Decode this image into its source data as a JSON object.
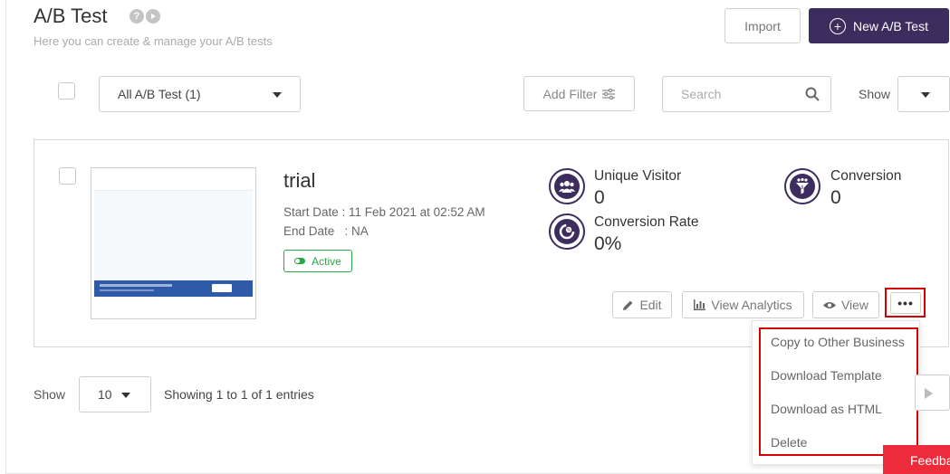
{
  "header": {
    "title": "A/B Test",
    "subtitle": "Here you can create & manage your A/B tests",
    "help_icon": "question-icon",
    "video_icon": "play-icon",
    "import_label": "Import",
    "new_label": "New A/B Test"
  },
  "toolbar": {
    "filter_select_value": "All A/B Test (1)",
    "add_filter_label": "Add Filter",
    "search_placeholder": "Search",
    "show_label": "Show"
  },
  "test_card": {
    "name": "trial",
    "start_date": "Start Date : 11 Feb 2021 at 02:52 AM",
    "end_date": "End Date   : NA",
    "status": "Active",
    "metrics": {
      "unique_visitor_label": "Unique Visitor",
      "unique_visitor_value": "0",
      "conversion_label": "Conversion",
      "conversion_value": "0",
      "conversion_rate_label": "Conversion Rate",
      "conversion_rate_value": "0%"
    },
    "actions": {
      "edit": "Edit",
      "view_analytics": "View Analytics",
      "view": "View",
      "more": "•••"
    }
  },
  "more_menu": [
    "Copy to Other Business",
    "Download Template",
    "Download as HTML",
    "Delete"
  ],
  "footer": {
    "show_label": "Show",
    "page_size": "10",
    "entries_text": "Showing 1 to 1 of 1 entries",
    "feedback_label": "Feedback"
  },
  "colors": {
    "primary": "#3d2c5e",
    "active_green": "#28a745",
    "highlight_red": "#d60000",
    "feedback_red": "#ee2b3b"
  }
}
